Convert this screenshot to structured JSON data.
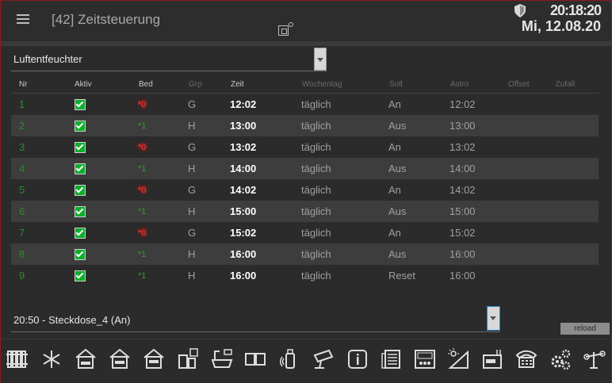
{
  "header": {
    "title": "[42] Zeitsteuerung",
    "time": "20:18:20",
    "date": "Mi, 12.08.20"
  },
  "device_select": {
    "value": "Luftentfeuchter"
  },
  "table": {
    "headers": [
      "Nr",
      "Aktiv",
      "Bed",
      "Grp",
      "Zeit",
      "Wochentag",
      "Soll",
      "Astro",
      "Offset",
      "Zufall"
    ],
    "rows": [
      {
        "nr": "1",
        "bed": "*0",
        "bed_state": "red",
        "grp": "G",
        "zeit": "12:02",
        "woche": "täglich",
        "soll": "An",
        "astro": "12:02"
      },
      {
        "nr": "2",
        "bed": "*1",
        "bed_state": "green",
        "grp": "H",
        "zeit": "13:00",
        "woche": "täglich",
        "soll": "Aus",
        "astro": "13:00"
      },
      {
        "nr": "3",
        "bed": "*0",
        "bed_state": "red",
        "grp": "G",
        "zeit": "13:02",
        "woche": "täglich",
        "soll": "An",
        "astro": "13:02"
      },
      {
        "nr": "4",
        "bed": "*1",
        "bed_state": "green",
        "grp": "H",
        "zeit": "14:00",
        "woche": "täglich",
        "soll": "Aus",
        "astro": "14:00"
      },
      {
        "nr": "5",
        "bed": "*0",
        "bed_state": "red",
        "grp": "G",
        "zeit": "14:02",
        "woche": "täglich",
        "soll": "An",
        "astro": "14:02"
      },
      {
        "nr": "6",
        "bed": "*1",
        "bed_state": "green",
        "grp": "H",
        "zeit": "15:00",
        "woche": "täglich",
        "soll": "Aus",
        "astro": "15:00"
      },
      {
        "nr": "7",
        "bed": "*0",
        "bed_state": "red",
        "grp": "G",
        "zeit": "15:02",
        "woche": "täglich",
        "soll": "An",
        "astro": "15:02"
      },
      {
        "nr": "8",
        "bed": "*1",
        "bed_state": "green",
        "grp": "H",
        "zeit": "16:00",
        "woche": "täglich",
        "soll": "Aus",
        "astro": "16:00"
      },
      {
        "nr": "9",
        "bed": "*1",
        "bed_state": "green",
        "grp": "H",
        "zeit": "16:00",
        "woche": "täglich",
        "soll": "Reset",
        "astro": "16:00"
      }
    ]
  },
  "schedule_select": {
    "value": "20:50 - Steckdose_4 (An)"
  },
  "reload_label": "reload",
  "toolbar": {
    "icons": [
      "radiator-icon",
      "snowflake-icon",
      "shutter-1-icon",
      "shutter-2-icon",
      "shutter-3-icon",
      "window-info-icon",
      "bath-icon",
      "book-icon",
      "sensor-icon",
      "camera-icon",
      "info-icon",
      "document-icon",
      "thermostat-icon",
      "sun-angle-icon",
      "nas-icon",
      "phone-icon",
      "gears-icon",
      "weather-station-icon"
    ]
  },
  "colors": {
    "accent_green": "#0fae2e",
    "active_red": "#ff3a3a",
    "nr_green": "#2e8b2e",
    "border": "#8a1a1a"
  }
}
